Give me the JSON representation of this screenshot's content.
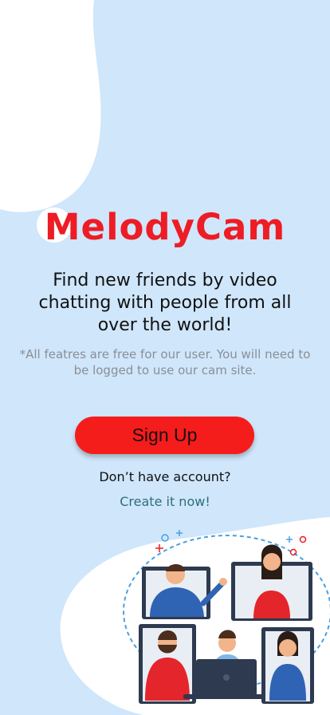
{
  "app": {
    "brand": "MelodyCam",
    "headline": "Find new friends by video chatting with people from all over the world!",
    "note": "*All featres are free  for our user. You will need to be logged to use our cam site."
  },
  "actions": {
    "signup_label": "Sign Up",
    "account_question": "Don’t have account?",
    "create_link": "Create it now!"
  },
  "colors": {
    "background": "#cfe6fb",
    "brand_red": "#ee1c24",
    "button_red": "#f51c1c",
    "link_teal": "#2f6e7a"
  },
  "illustration": {
    "icon": "video-chat-people-illustration"
  }
}
